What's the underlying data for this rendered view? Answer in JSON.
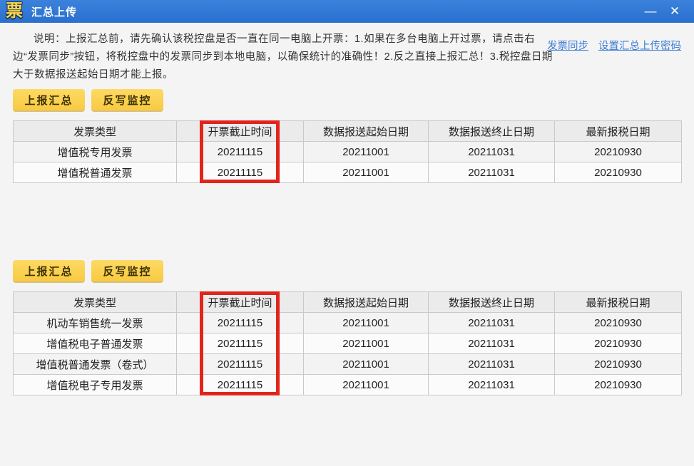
{
  "window": {
    "icon_glyph": "票",
    "title": "汇总上传",
    "minimize_glyph": "—",
    "close_glyph": "✕"
  },
  "notice": {
    "text": "说明：上报汇总前，请先确认该税控盘是否一直在同一电脑上开票：1.如果在多台电脑上开过票，请点击右边“发票同步”按钮，将税控盘中的发票同步到本地电脑，以确保统计的准确性！2.反之直接上报汇总！3.税控盘日期大于数据报送起始日期才能上报。"
  },
  "links": [
    {
      "label": "发票同步"
    },
    {
      "label": "设置汇总上传密码"
    }
  ],
  "actions": {
    "report_label": "上报汇总",
    "writeback_label": "反写监控"
  },
  "headers": [
    "发票类型",
    "开票截止时间",
    "数据报送起始日期",
    "数据报送终止日期",
    "最新报税日期"
  ],
  "table1": {
    "rows": [
      [
        "增值税专用发票",
        "20211115",
        "20211001",
        "20211031",
        "20210930"
      ],
      [
        "增值税普通发票",
        "20211115",
        "20211001",
        "20211031",
        "20210930"
      ]
    ]
  },
  "table2": {
    "rows": [
      [
        "机动车销售统一发票",
        "20211115",
        "20211001",
        "20211031",
        "20210930"
      ],
      [
        "增值税电子普通发票",
        "20211115",
        "20211001",
        "20211031",
        "20210930"
      ],
      [
        "增值税普通发票（卷式）",
        "20211115",
        "20211001",
        "20211031",
        "20210930"
      ],
      [
        "增值税电子专用发票",
        "20211115",
        "20211001",
        "20211031",
        "20210930"
      ]
    ]
  },
  "colors": {
    "titlebar_blue": "#2f76d3",
    "button_yellow": "#f8ca40",
    "link_blue": "#3a7bd5",
    "highlight_red": "#e1251c"
  }
}
